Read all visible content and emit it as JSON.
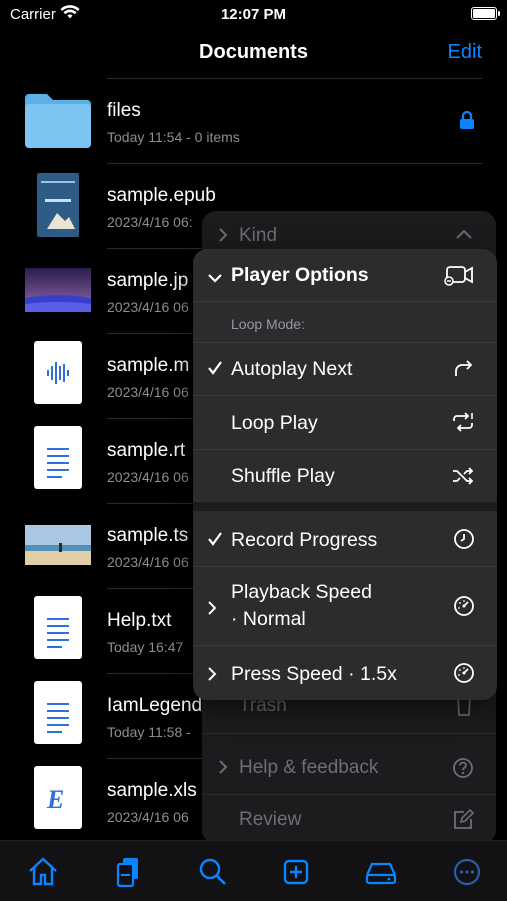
{
  "status_bar": {
    "carrier": "Carrier",
    "time": "12:07 PM"
  },
  "nav": {
    "title": "Documents",
    "edit_label": "Edit"
  },
  "files": [
    {
      "name": "files",
      "subtitle": "Today 11:54 - 0 items",
      "icon": "folder-icon"
    },
    {
      "name": "sample.epub",
      "subtitle": "2023/4/16 06:",
      "icon": "epub-cover-icon"
    },
    {
      "name": "sample.jp",
      "subtitle": "2023/4/16 06",
      "icon": "image-thumbnail"
    },
    {
      "name": "sample.m",
      "subtitle": "2023/4/16 06",
      "icon": "audio-file-icon"
    },
    {
      "name": "sample.rt",
      "subtitle": "2023/4/16 06",
      "icon": "text-file-icon"
    },
    {
      "name": "sample.ts",
      "subtitle": "2023/4/16 06",
      "icon": "video-thumbnail"
    },
    {
      "name": "Help.txt",
      "subtitle": "Today 16:47",
      "icon": "text-file-icon"
    },
    {
      "name": "IamLegend",
      "subtitle": "Today 11:58 -",
      "icon": "text-file-icon"
    },
    {
      "name": "sample.xls",
      "subtitle": "2023/4/16 06",
      "icon": "excel-file-icon"
    }
  ],
  "back_menu": {
    "kind_label": "Kind",
    "trash_label": "Trash",
    "help_label": "Help & feedback",
    "review_label": "Review"
  },
  "player_menu": {
    "title": "Player Options",
    "section_label": "Loop Mode:",
    "autoplay_label": "Autoplay Next",
    "loop_label": "Loop Play",
    "shuffle_label": "Shuffle Play",
    "record_label": "Record Progress",
    "speed_line1": "Playback Speed",
    "speed_line2": "· Normal",
    "press_speed_label": "Press Speed · 1.5x"
  },
  "colors": {
    "accent": "#0a84ff",
    "folder": "#7cc4f2"
  },
  "tabbar_icons": [
    "home-icon",
    "documents-icon",
    "search-icon",
    "add-icon",
    "drive-icon",
    "more-icon"
  ]
}
